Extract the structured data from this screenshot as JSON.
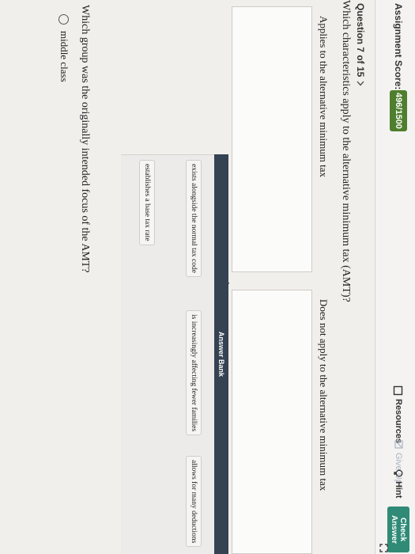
{
  "header": {
    "score_label": "Assignment Score:",
    "score_value": "496/1500",
    "resources_label": "Resources",
    "give_up_label": "Give Up?",
    "hint_label": "Hint",
    "check_answer_label": "Check Answer"
  },
  "question": {
    "number_label": "Question 7 of 15",
    "text": "Which characteristics apply to the alternative minimum tax (AMT)?",
    "left_heading": "Applies to the alternative minimum tax",
    "right_heading": "Does not apply to the alternative minimum tax"
  },
  "answer_bank": {
    "title": "Answer Bank",
    "items": [
      "exists alongside the normal tax code",
      "is increasingly affecting fewer families",
      "allows for many deductions",
      "establishes a base tax rate"
    ]
  },
  "question2": {
    "text": "Which group was the originally intended focus of the AMT?",
    "options": [
      "middle class"
    ]
  },
  "colors": {
    "score_badge": "#4f7f2e",
    "check_answer": "#2f8a76",
    "bank_header": "#344252"
  }
}
